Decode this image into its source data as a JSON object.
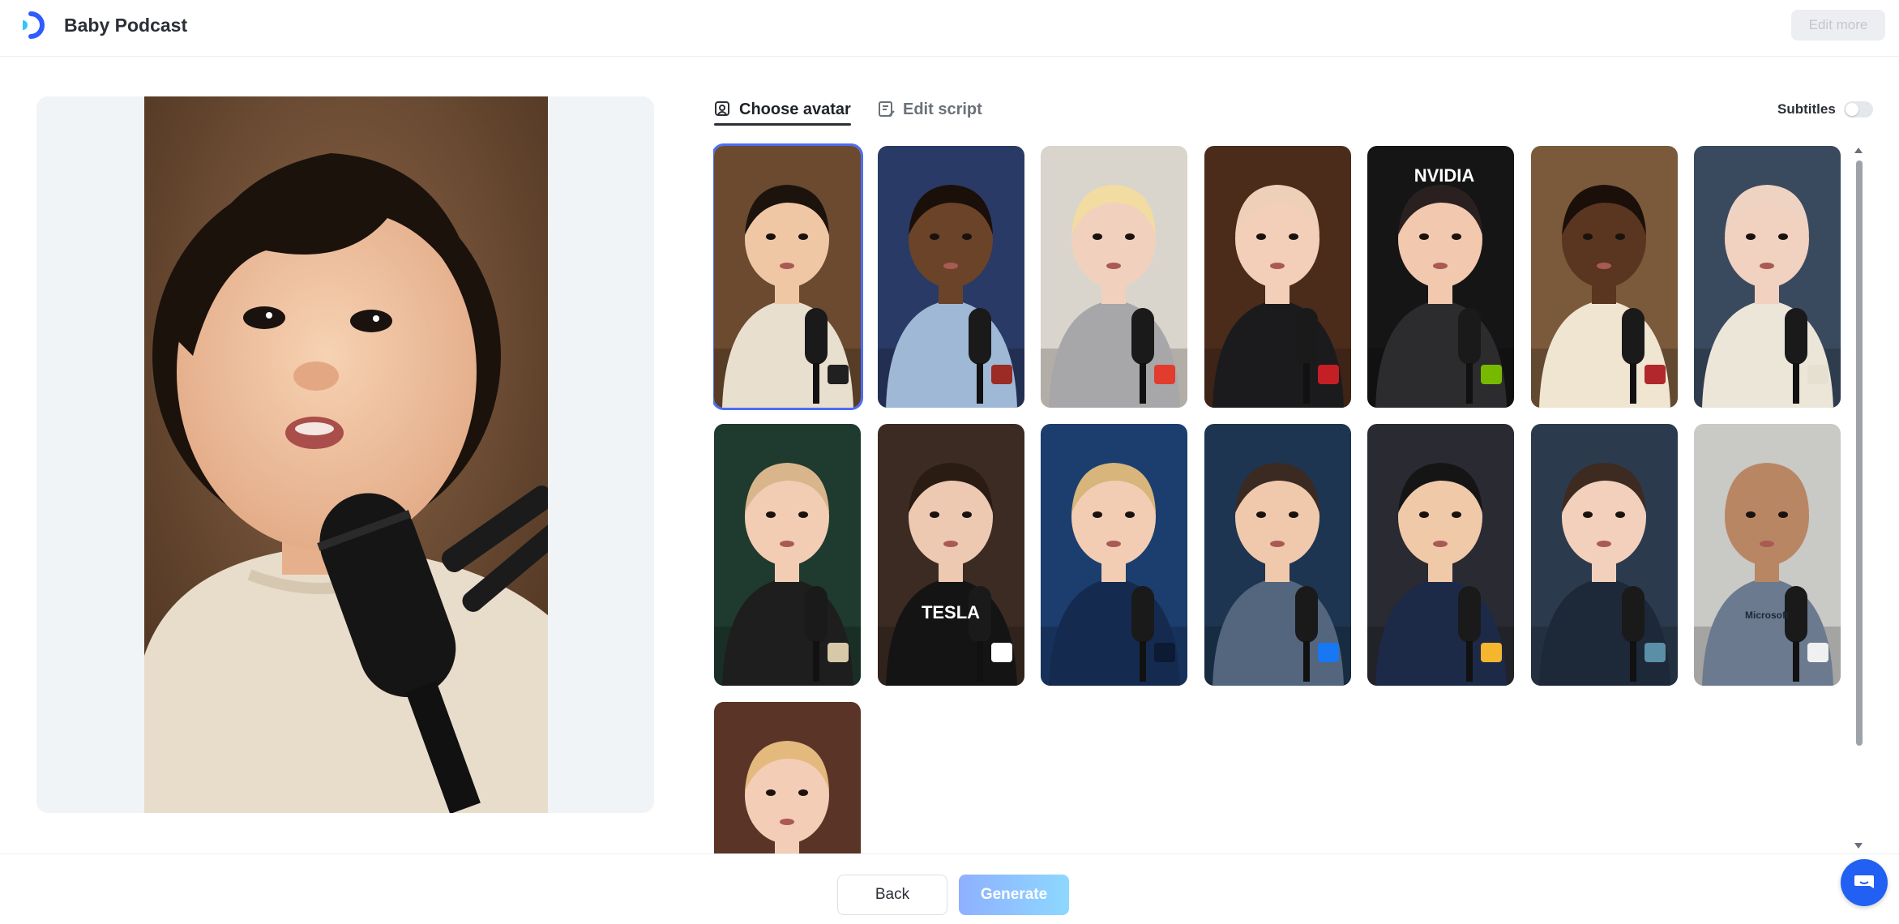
{
  "header": {
    "app_title": "Baby Podcast",
    "edit_more_label": "Edit more",
    "logo_icon": "brand-logo-icon"
  },
  "tabs": [
    {
      "label": "Choose avatar",
      "icon": "avatar-select-icon",
      "active": true
    },
    {
      "label": "Edit script",
      "icon": "script-edit-icon",
      "active": false
    }
  ],
  "subtitles": {
    "label": "Subtitles",
    "enabled": false
  },
  "preview": {
    "selected_avatar_index": 0
  },
  "avatars": [
    {
      "bg": "#6b4a2f",
      "skin": "#f0c7a4",
      "hair": "#1c130d",
      "shirt": "#e9dfcf",
      "accent": "#202020",
      "text": ""
    },
    {
      "bg": "#2a3a66",
      "skin": "#6b4328",
      "hair": "#1a0f09",
      "shirt": "#9fb8d6",
      "accent": "#9b2b24",
      "text": ""
    },
    {
      "bg": "#d9d5cc",
      "skin": "#f1d1bd",
      "hair": "#f2dca2",
      "shirt": "#a7a7aa",
      "accent": "#e23c2e",
      "text": ""
    },
    {
      "bg": "#4b2c1b",
      "skin": "#f3cfba",
      "hair": "#eecfb8",
      "shirt": "#1b1b1d",
      "accent": "#c41f25",
      "text": ""
    },
    {
      "bg": "#151515",
      "skin": "#f2c8ae",
      "hair": "#2b2020",
      "shirt": "#2c2c2e",
      "accent": "#76b900",
      "text": "NVIDIA"
    },
    {
      "bg": "#7b5a3c",
      "skin": "#5a3520",
      "hair": "#1a0f09",
      "shirt": "#efe5d0",
      "accent": "#b1272b",
      "text": ""
    },
    {
      "bg": "#3a4a5e",
      "skin": "#f1d1bf",
      "hair": "#efd3c2",
      "shirt": "#ece6d9",
      "accent": "#e6e0d0",
      "text": ""
    },
    {
      "bg": "#1f3a2f",
      "skin": "#f2cdb3",
      "hair": "#d9b58c",
      "shirt": "#1e1e1e",
      "accent": "#d7c9a7",
      "text": ""
    },
    {
      "bg": "#3b2b23",
      "skin": "#eec9b2",
      "hair": "#2a1b13",
      "shirt": "#141414",
      "accent": "#ffffff",
      "text": "TESLA"
    },
    {
      "bg": "#1b3e6f",
      "skin": "#f2cdb4",
      "hair": "#d8b57a",
      "shirt": "#152a4f",
      "accent": "#0d1a33",
      "text": ""
    },
    {
      "bg": "#1d3550",
      "skin": "#f0c9ad",
      "hair": "#3a2a22",
      "shirt": "#54657e",
      "accent": "#1877f2",
      "text": ""
    },
    {
      "bg": "#2a2a33",
      "skin": "#f0c9a9",
      "hair": "#151515",
      "shirt": "#1c2a48",
      "accent": "#f5b52e",
      "text": ""
    },
    {
      "bg": "#2b3b4d",
      "skin": "#f2d0bb",
      "hair": "#3d2b22",
      "shirt": "#1d2838",
      "accent": "#5a8fa6",
      "text": ""
    },
    {
      "bg": "#c9c9c6",
      "skin": "#b98664",
      "hair": "#b98664",
      "shirt": "#6b7a8f",
      "accent": "#f0f0f0",
      "text": "Microsoft"
    },
    {
      "bg": "#5a3426",
      "skin": "#f3cdb6",
      "hair": "#e3b97d",
      "shirt": "#152553",
      "accent": "#d2182c",
      "text": ""
    }
  ],
  "footer": {
    "back_label": "Back",
    "generate_label": "Generate",
    "chat_icon": "chat-support-icon"
  }
}
